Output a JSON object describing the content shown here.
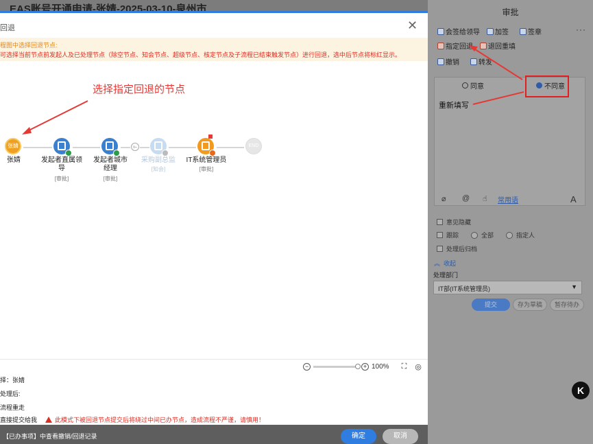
{
  "background": {
    "title": "EAS账号开通申请-张婧-2025-03-10-泉州市"
  },
  "right_panel": {
    "title": "审批",
    "more": "···",
    "buttons": {
      "countersign": "会签给领导",
      "add_sign": "加签",
      "sign": "签章",
      "designated_return": "指定回退",
      "return_refill": "退回重填",
      "revoke": "撤销",
      "forward": "转发"
    },
    "tabs": {
      "agree": "同意",
      "disagree": "不同意"
    },
    "opinion_text": "重新填写",
    "tools": {
      "attach_icon": "paperclip-icon",
      "mention": "@",
      "like_icon": "thumbs-up-icon",
      "common_phrases": "常用语",
      "font": "A"
    },
    "options": {
      "hide_opinion": "意见隐藏",
      "track": "跟踪",
      "track_all": "全部",
      "track_designated": "指定人",
      "archive_after": "处理后归档",
      "collapse": "收起"
    },
    "dept_label": "处理部门",
    "dept_value": "IT部(IT系统管理员)",
    "actions": {
      "submit": "提交",
      "save_draft": "存为草稿",
      "hold": "暂存待办"
    },
    "float_label": "K"
  },
  "modal": {
    "title": "回退",
    "notice_line1": "程图中选择回退节点:",
    "notice_line2": "可选择当前节点前发起人及已处理节点（除空节点、知会节点、超级节点、核定节点及子流程已结束触发节点）进行回退，选中后节点将标红显示。",
    "annotation": "选择指定回退的节点",
    "nodes": [
      {
        "avatar": "张婧",
        "name": "张婧",
        "sub": "",
        "style": "orange"
      },
      {
        "name": "发起者直属领导",
        "sub": "[审批]",
        "style": "blue"
      },
      {
        "name": "发起者城市经理",
        "sub": "[审批]",
        "style": "blue"
      },
      {
        "name": "采购副总监",
        "sub": "[知会]",
        "style": "faded"
      },
      {
        "name": "IT系统管理员",
        "sub": "[审批]",
        "style": "gold"
      },
      {
        "end_label": "END",
        "style": "end"
      }
    ],
    "zoom": "100%",
    "info": {
      "choose": "择：张婧",
      "after_process": "处理后:",
      "flow_rerun": "流程重走",
      "direct_submit": "直接提交给我",
      "warning": "此模式下被回退节点提交后将绕过中间已办节点，造成流程不严谨，请慎用！"
    },
    "footer": {
      "text": "【已办事项】中查看撤销/回退记录",
      "ok": "确定",
      "cancel": "取消"
    }
  }
}
